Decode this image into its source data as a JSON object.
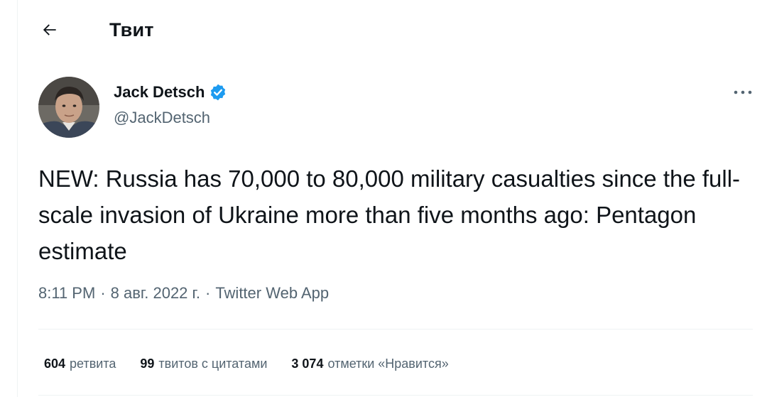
{
  "header": {
    "title": "Твит"
  },
  "author": {
    "name": "Jack Detsch",
    "handle": "@JackDetsch"
  },
  "tweet": {
    "text": "NEW: Russia has 70,000 to 80,000 military casualties since the full-scale invasion of Ukraine more than five months ago: Pentagon estimate",
    "time": "8:11 PM",
    "date": "8 авг. 2022 г.",
    "source": "Twitter Web App"
  },
  "stats": [
    {
      "count": "604",
      "label": "ретвита"
    },
    {
      "count": "99",
      "label": "твитов с цитатами"
    },
    {
      "count": "3 074",
      "label": "отметки «Нравится»"
    }
  ],
  "colors": {
    "verified": "#1d9bf0",
    "secondary_text": "#536471"
  }
}
